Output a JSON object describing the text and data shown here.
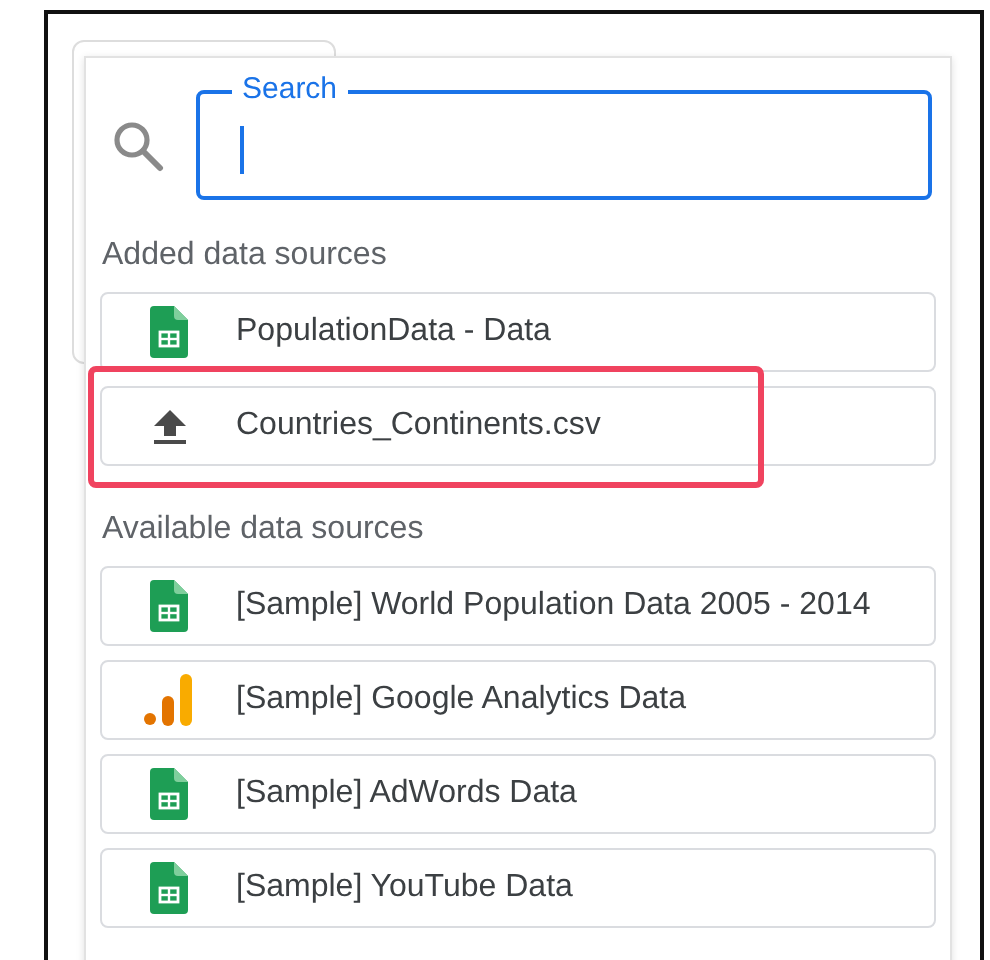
{
  "search": {
    "label": "Search",
    "focused": true
  },
  "sections": [
    {
      "title": "Added data sources",
      "items": [
        {
          "kind": "sheets",
          "name": "PopulationData - Data",
          "highlighted": false
        },
        {
          "kind": "upload",
          "name": "Countries_Continents.csv",
          "highlighted": true
        }
      ]
    },
    {
      "title": "Available data sources",
      "items": [
        {
          "kind": "sheets",
          "name": "[Sample] World Population Data 2005 - 2014",
          "highlighted": false
        },
        {
          "kind": "analytics",
          "name": "[Sample] Google Analytics Data",
          "highlighted": false
        },
        {
          "kind": "sheets",
          "name": "[Sample] AdWords Data",
          "highlighted": false
        },
        {
          "kind": "sheets",
          "name": "[Sample] YouTube Data",
          "highlighted": false
        }
      ]
    }
  ]
}
